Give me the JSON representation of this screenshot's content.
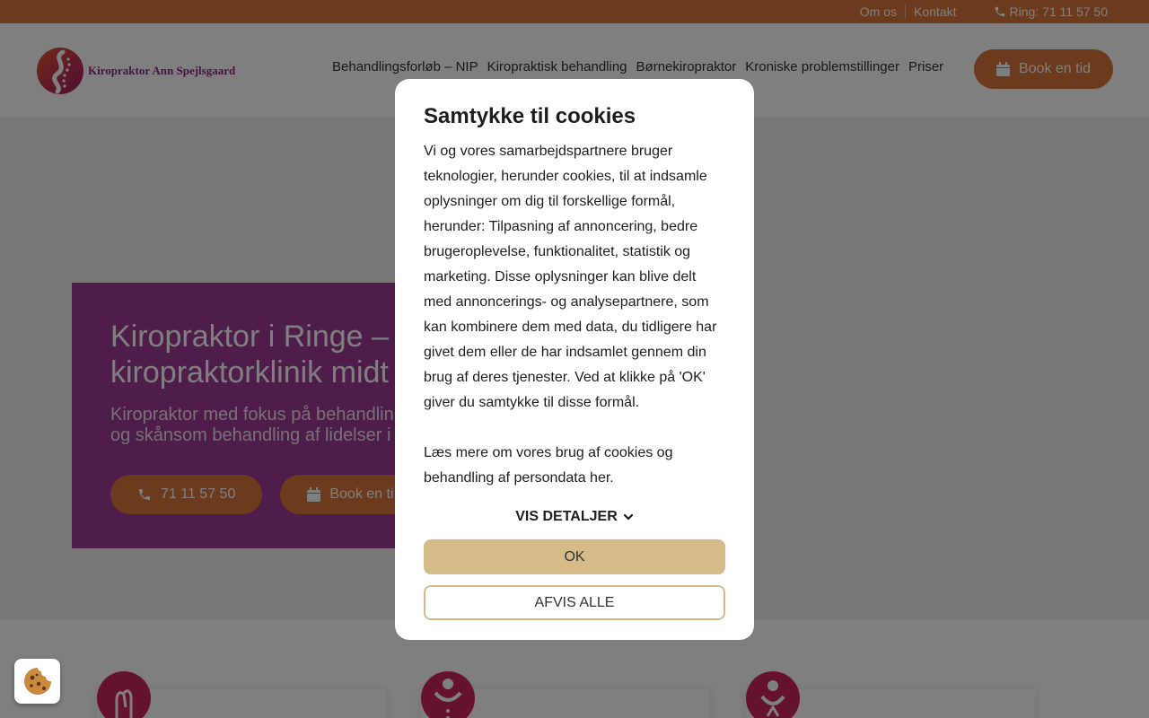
{
  "topbar": {
    "links": [
      "Om os",
      "Kontakt"
    ],
    "phone": "Ring: 71 11 57 50"
  },
  "header": {
    "logo_text": "Kiropraktor Ann Spejlsgaard",
    "nav": [
      "Behandlingsforløb – NIP",
      "Kiropraktisk behandling",
      "Børnekiropraktor",
      "Kroniske problemstillinger",
      "Priser"
    ],
    "book_label": "Book en tid"
  },
  "hero": {
    "title_line1": "Kiropraktor i Ringe –",
    "title_line2": "kiropraktorklinik midt",
    "sub_line1": "Kiropraktor med fokus på behandlin",
    "sub_line2": "og skånsom behandling af lidelser i",
    "phone_btn": "71 11 57 50",
    "book_btn": "Book en ti"
  },
  "cookie_modal": {
    "title": "Samtykke til cookies",
    "body": "Vi og vores samarbejdspartnere bruger teknologier, herunder cookies, til at indsamle oplysninger om dig til forskellige formål, herunder: Tilpasning af annoncering, bedre brugeroplevelse, funktionalitet, statistik og marketing. Disse oplysninger kan blive delt med annoncerings- og analysepartnere, som kan kombinere dem med data, du tidligere har givet dem eller de har indsamlet gennem din brug af deres tjenester. Ved at klikke på 'OK' giver du samtykke til disse formål.",
    "more": "Læs mere om vores brug af cookies og behandling af persondata her.",
    "details_label": "VIS DETALJER",
    "ok_label": "OK",
    "reject_label": "AFVIS ALLE"
  },
  "colors": {
    "accent_orange": "#d8743a",
    "hero_purple": "#9c3b93",
    "button_gold": "#d5bb88",
    "logo_magenta": "#c9245d"
  },
  "icons": [
    "phone-icon",
    "calendar-icon",
    "chevron-down-icon",
    "cookie-icon",
    "logo-icon"
  ]
}
